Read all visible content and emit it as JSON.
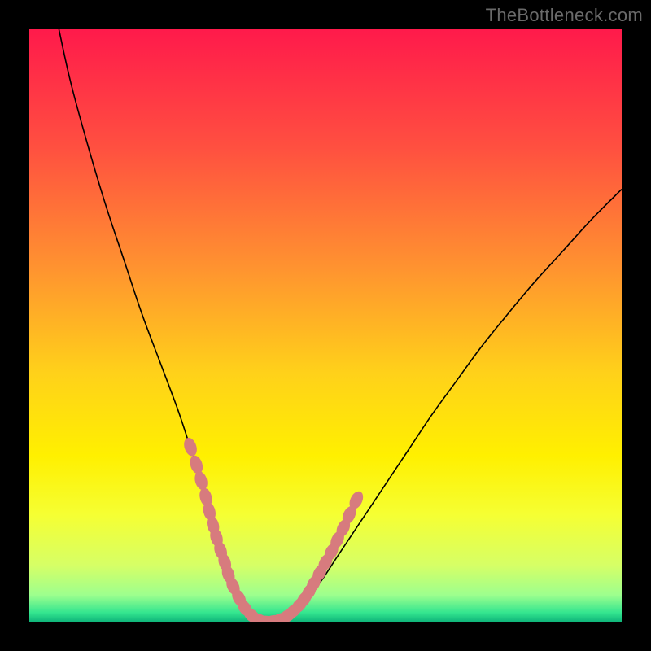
{
  "watermark": "TheBottleneck.com",
  "colors": {
    "frame": "#000000",
    "curve": "#000000",
    "marker_fill": "#d77b7e",
    "marker_stroke": "#d77b7e",
    "gradient_stops": [
      {
        "offset": 0.0,
        "color": "#ff1a4b"
      },
      {
        "offset": 0.2,
        "color": "#ff5040"
      },
      {
        "offset": 0.4,
        "color": "#ff9230"
      },
      {
        "offset": 0.58,
        "color": "#ffd11a"
      },
      {
        "offset": 0.72,
        "color": "#fff000"
      },
      {
        "offset": 0.82,
        "color": "#f5ff33"
      },
      {
        "offset": 0.905,
        "color": "#d6ff66"
      },
      {
        "offset": 0.955,
        "color": "#9dff8e"
      },
      {
        "offset": 0.985,
        "color": "#33e58f"
      },
      {
        "offset": 1.0,
        "color": "#0fb67a"
      }
    ]
  },
  "chart_data": {
    "type": "line",
    "title": "",
    "xlabel": "",
    "ylabel": "",
    "xlim": [
      0,
      100
    ],
    "ylim": [
      0,
      100
    ],
    "grid": false,
    "legend": false,
    "series": [
      {
        "name": "curve",
        "x": [
          5,
          7,
          10,
          13,
          16,
          19,
          22,
          25,
          27,
          29,
          30.5,
          32,
          33.5,
          35,
          36.5,
          38,
          40,
          42,
          44,
          46,
          49,
          52,
          56,
          60,
          64,
          68,
          72,
          76,
          80,
          85,
          90,
          95,
          100
        ],
        "y": [
          100,
          91,
          80,
          70,
          61,
          52,
          44,
          36,
          30,
          24,
          19,
          14,
          10,
          6,
          3,
          1,
          0,
          0.3,
          1.2,
          3,
          6.5,
          11,
          17,
          23,
          29,
          35,
          40.5,
          46,
          51,
          57,
          62.5,
          68,
          73
        ]
      }
    ],
    "markers": {
      "name": "highlighted-points",
      "x": [
        27.2,
        28.2,
        29.0,
        29.8,
        30.4,
        31.0,
        31.6,
        32.3,
        33.0,
        33.6,
        34.4,
        35.4,
        36.4,
        37.6,
        38.8,
        40.0,
        41.2,
        42.4,
        43.6,
        44.6,
        45.6,
        46.4,
        47.2,
        48.0,
        49.0,
        50.0,
        51.0,
        52.0,
        53.0,
        54.0,
        55.2
      ],
      "y": [
        29.5,
        26.5,
        23.8,
        21.0,
        18.6,
        16.3,
        14.2,
        12.0,
        10.0,
        8.0,
        6.0,
        4.0,
        2.3,
        1.0,
        0.3,
        0.0,
        0.1,
        0.4,
        1.0,
        1.8,
        2.8,
        3.8,
        5.0,
        6.4,
        8.2,
        10.0,
        11.8,
        13.8,
        15.8,
        18.0,
        20.5
      ]
    }
  }
}
